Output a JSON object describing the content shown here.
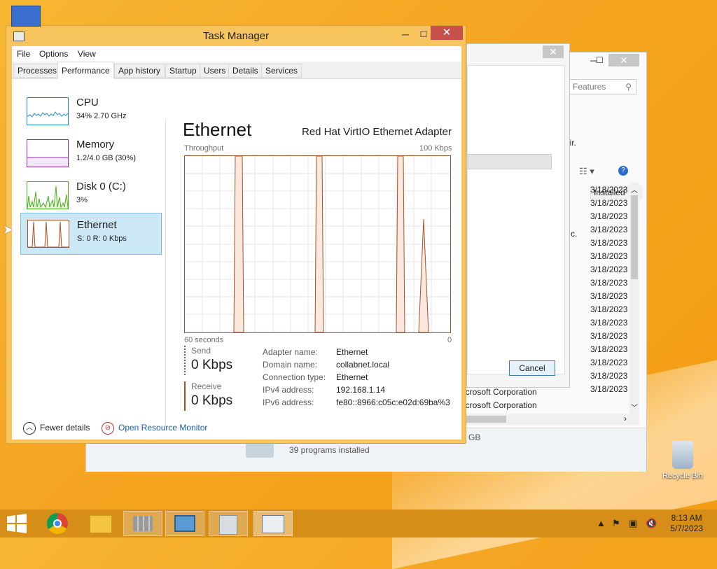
{
  "window": {
    "title": "Task Manager",
    "minimize": "─",
    "maximize": "☐",
    "close": "✕"
  },
  "menu": [
    "File",
    "Options",
    "View"
  ],
  "tabs": [
    "Processes",
    "Performance",
    "App history",
    "Startup",
    "Users",
    "Details",
    "Services"
  ],
  "active_tab": "Performance",
  "sidebar": [
    {
      "name": "CPU",
      "value": "34%  2.70 GHz",
      "color": "#1e88c7"
    },
    {
      "name": "Memory",
      "value": "1.2/4.0 GB (30%)",
      "color": "#8b2fa8"
    },
    {
      "name": "Disk 0 (C:)",
      "value": "3%",
      "color": "#4caf1f"
    },
    {
      "name": "Ethernet",
      "value": "S: 0  R: 0 Kbps",
      "color": "#a0522d"
    }
  ],
  "main": {
    "title": "Ethernet",
    "adapter": "Red Hat VirtIO Ethernet Adapter",
    "throughput_label": "Throughput",
    "max_label": "100 Kbps",
    "time_label": "60 seconds",
    "min_label": "0",
    "send_label": "Send",
    "send_value": "0 Kbps",
    "receive_label": "Receive",
    "receive_value": "0 Kbps",
    "properties": [
      {
        "k": "Adapter name:",
        "v": "Ethernet"
      },
      {
        "k": "Domain name:",
        "v": "collabnet.local"
      },
      {
        "k": "Connection type:",
        "v": "Ethernet"
      },
      {
        "k": "IPv4 address:",
        "v": "192.168.1.14"
      },
      {
        "k": "IPv6 address:",
        "v": "fe80::8966:c05c:e02d:69ba%3"
      }
    ]
  },
  "footer": {
    "fewer_details": "Fewer details",
    "resource_monitor": "Open Resource Monitor"
  },
  "background": {
    "search_placeholder": "d Features",
    "repair_fragment": "air.",
    "c_fragment": "c.",
    "installed_header": "Installed",
    "installed_dates": [
      "3/18/2023",
      "3/18/2023",
      "3/18/2023",
      "3/18/2023",
      "3/18/2023",
      "3/18/2023",
      "3/18/2023",
      "3/18/2023",
      "3/18/2023",
      "3/18/2023",
      "3/18/2023",
      "3/18/2023",
      "3/18/2023",
      "3/18/2023",
      "3/18/2023",
      "3/18/2023"
    ],
    "corp1": "icrosoft Corporation",
    "corp2": "icrosoft Corporation",
    "cancel": "Cancel",
    "programs_installed": "39 programs installed",
    "gb": "GB"
  },
  "desktop": {
    "recycle_bin": "Recycle Bin"
  },
  "clock": {
    "time": "8:13 AM",
    "date": "5/7/2023"
  }
}
